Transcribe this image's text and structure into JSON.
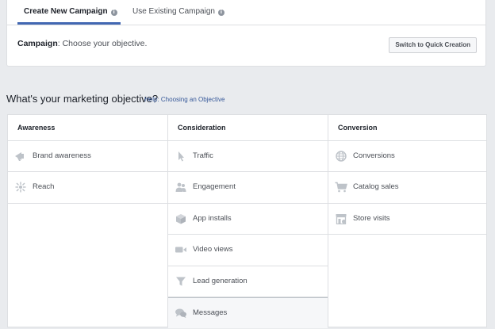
{
  "tabs": [
    {
      "label": "Create New Campaign",
      "active": true
    },
    {
      "label": "Use Existing Campaign",
      "active": false
    }
  ],
  "campaign": {
    "label": "Campaign",
    "text": ": Choose your objective.",
    "quick_button": "Switch to Quick Creation"
  },
  "objective": {
    "heading": "What's your marketing objective?",
    "help_link": "Help: Choosing an Objective"
  },
  "columns": {
    "awareness": {
      "title": "Awareness",
      "items": [
        {
          "label": "Brand awareness",
          "icon": "megaphone-icon"
        },
        {
          "label": "Reach",
          "icon": "reach-icon"
        }
      ]
    },
    "consideration": {
      "title": "Consideration",
      "items": [
        {
          "label": "Traffic",
          "icon": "cursor-icon"
        },
        {
          "label": "Engagement",
          "icon": "people-icon"
        },
        {
          "label": "App installs",
          "icon": "box-icon"
        },
        {
          "label": "Video views",
          "icon": "video-camera-icon"
        },
        {
          "label": "Lead generation",
          "icon": "funnel-icon"
        },
        {
          "label": "Messages",
          "icon": "chat-bubbles-icon"
        }
      ]
    },
    "conversion": {
      "title": "Conversion",
      "items": [
        {
          "label": "Conversions",
          "icon": "globe-icon"
        },
        {
          "label": "Catalog sales",
          "icon": "shopping-cart-icon"
        },
        {
          "label": "Store visits",
          "icon": "store-icon"
        }
      ]
    }
  },
  "colors": {
    "accent": "#4267b2",
    "link": "#365899",
    "icon": "#bec3c9"
  }
}
